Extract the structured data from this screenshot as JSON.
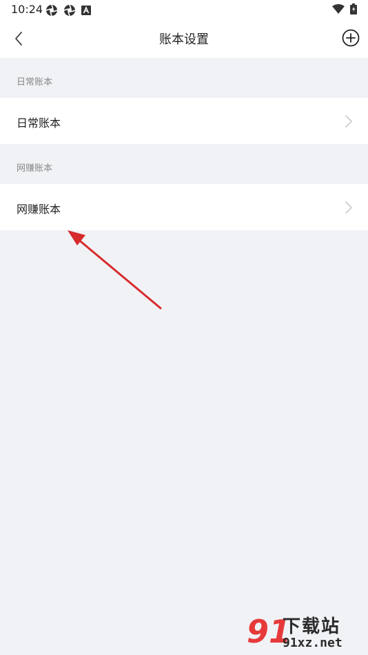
{
  "status_bar": {
    "time": "10:24",
    "icons": [
      "aperture-icon",
      "aperture-icon",
      "font-a-icon"
    ],
    "right_icons": [
      "wifi-icon",
      "battery-charging-icon"
    ]
  },
  "nav": {
    "title": "账本设置",
    "back_icon": "chevron-left-icon",
    "add_icon": "plus-circle-icon"
  },
  "sections": [
    {
      "header": "日常账本",
      "items": [
        {
          "label": "日常账本"
        }
      ]
    },
    {
      "header": "网赚账本",
      "items": [
        {
          "label": "网赚账本"
        }
      ]
    }
  ],
  "annotation": {
    "color": "#d62b2b"
  },
  "watermark": {
    "logo_text": "91",
    "brand": "下载站",
    "site": "91xz.net"
  },
  "colors": {
    "background": "#f1f2f6",
    "surface": "#ffffff",
    "text": "#222222",
    "secondary_text": "#888888",
    "chevron": "#c8c8c8"
  }
}
